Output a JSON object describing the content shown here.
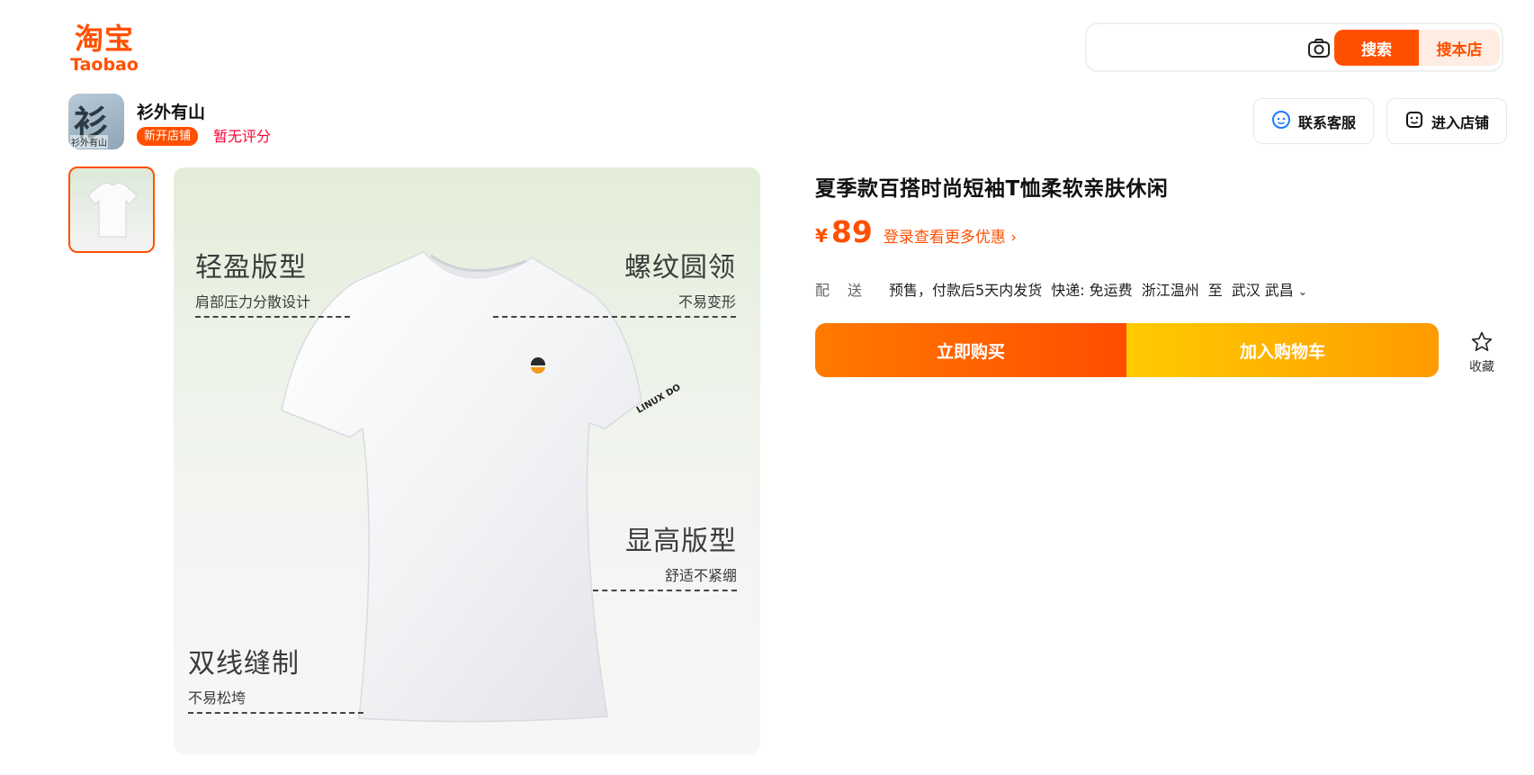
{
  "logo": {
    "cn": "淘宝",
    "en": "Taobao"
  },
  "search": {
    "value": "",
    "search_label": "搜索",
    "store_label": "搜本店"
  },
  "shop": {
    "avatar_text": "衫外有山",
    "avatar_glyph": "衫",
    "name": "衫外有山",
    "badge": "新开店铺",
    "rating": "暂无评分",
    "contact_label": "联系客服",
    "enter_label": "进入店铺"
  },
  "gallery": {
    "features": [
      {
        "title": "轻盈版型",
        "sub": "肩部压力分散设计"
      },
      {
        "title": "螺纹圆领",
        "sub": "不易变形"
      },
      {
        "title": "显高版型",
        "sub": "舒适不紧绷"
      },
      {
        "title": "双线缝制",
        "sub": "不易松垮"
      }
    ],
    "sleeve_text": "LINUX DO"
  },
  "product": {
    "title": "夏季款百搭时尚短袖T恤柔软亲肤休闲",
    "currency": "¥",
    "price": "89",
    "promo": "登录查看更多优惠"
  },
  "shipping": {
    "label": "配送",
    "presale": "预售，付款后5天内发货",
    "express": "快递: 免运费",
    "origin": "浙江温州",
    "to": "至",
    "destination": "武汉 武昌"
  },
  "actions": {
    "buy_now": "立即购买",
    "add_cart": "加入购物车",
    "favorite": "收藏"
  },
  "colors": {
    "brand": "#ff5000",
    "rating": "#ff0036"
  }
}
